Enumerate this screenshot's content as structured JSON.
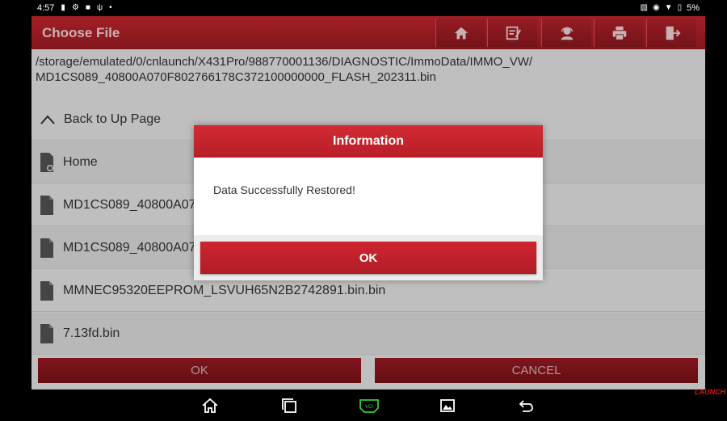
{
  "status_bar": {
    "time": "4:57",
    "battery_percent": "5%"
  },
  "titlebar": {
    "title": "Choose File",
    "actions": [
      {
        "icon": "home-icon"
      },
      {
        "icon": "edit-report-icon"
      },
      {
        "icon": "support-agent-icon"
      },
      {
        "icon": "print-icon"
      },
      {
        "icon": "exit-icon"
      }
    ]
  },
  "path": {
    "line1": "/storage/emulated/0/cnlaunch/X431Pro/988770001136/DIAGNOSTIC/ImmoData/IMMO_VW/",
    "line2": "MD1CS089_40800A070F802766178C372100000000_FLASH_202311.bin"
  },
  "back_row": {
    "label": "Back to Up Page"
  },
  "files": [
    {
      "label": "Home",
      "icon": "folder-settings-icon"
    },
    {
      "label": "MD1CS089_40800A07",
      "icon": "file-icon"
    },
    {
      "label": "MD1CS089_40800A07",
      "icon": "file-icon"
    },
    {
      "label": "MMNEC95320EEPROM_LSVUH65N2B2742891.bin.bin",
      "icon": "file-icon"
    },
    {
      "label": "7.13fd.bin",
      "icon": "file-icon"
    }
  ],
  "buttons": {
    "ok": "OK",
    "cancel": "CANCEL"
  },
  "dialog": {
    "title": "Information",
    "message": "Data Successfully Restored!",
    "ok": "OK"
  },
  "navbar": {
    "vci_label": "VCI"
  },
  "brand": "LAUNCH",
  "colors": {
    "accent_red": "#c9262f",
    "vci_green": "#2ecc40"
  }
}
